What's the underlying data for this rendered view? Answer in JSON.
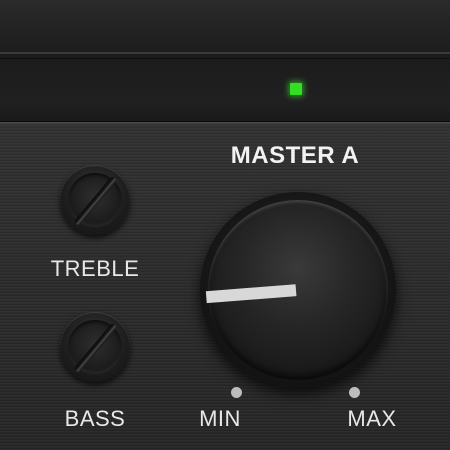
{
  "status": {
    "led_color": "#33dd22",
    "led_state": "on"
  },
  "master": {
    "title": "MASTER A",
    "min_label": "MIN",
    "max_label": "MAX",
    "level": 0.15
  },
  "knobs": [
    {
      "label": "TREBLE"
    },
    {
      "label": "BASS"
    }
  ],
  "colors": {
    "panel": "#2b2b2c",
    "text": "#e8e8e8",
    "pointer": "#d8d8d8"
  }
}
